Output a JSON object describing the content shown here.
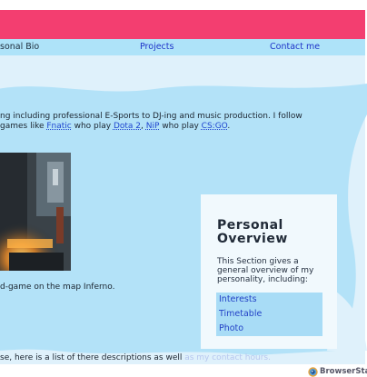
{
  "nav": {
    "items": [
      {
        "label": "sonal Bio"
      },
      {
        "label": "Projects"
      },
      {
        "label": "Contact me"
      }
    ]
  },
  "intro": {
    "line1": "ng including professional E-Sports to DJ-ing and music production. I follow",
    "line2_prefix": " games like ",
    "link_fnatic": "Fnatic",
    "line2_middle": " who play ",
    "link_dota": "Dota 2",
    "sep": ", ",
    "link_nip": "NiP",
    "line2_middle2": " who play ",
    "link_csgo": "CS:GO",
    "line2_end": "."
  },
  "caption": "d-game on the map Inferno.",
  "overview": {
    "title": "Personal Overview",
    "description": "This Section gives a general overview of my personality, including:",
    "links": [
      "Interests",
      "Timetable",
      "Photo"
    ]
  },
  "bottom": {
    "text": "se, here is a list of there descriptions as well ",
    "faded_link": "as my contact hours."
  },
  "footer": {
    "brand": "BrowserStack"
  }
}
